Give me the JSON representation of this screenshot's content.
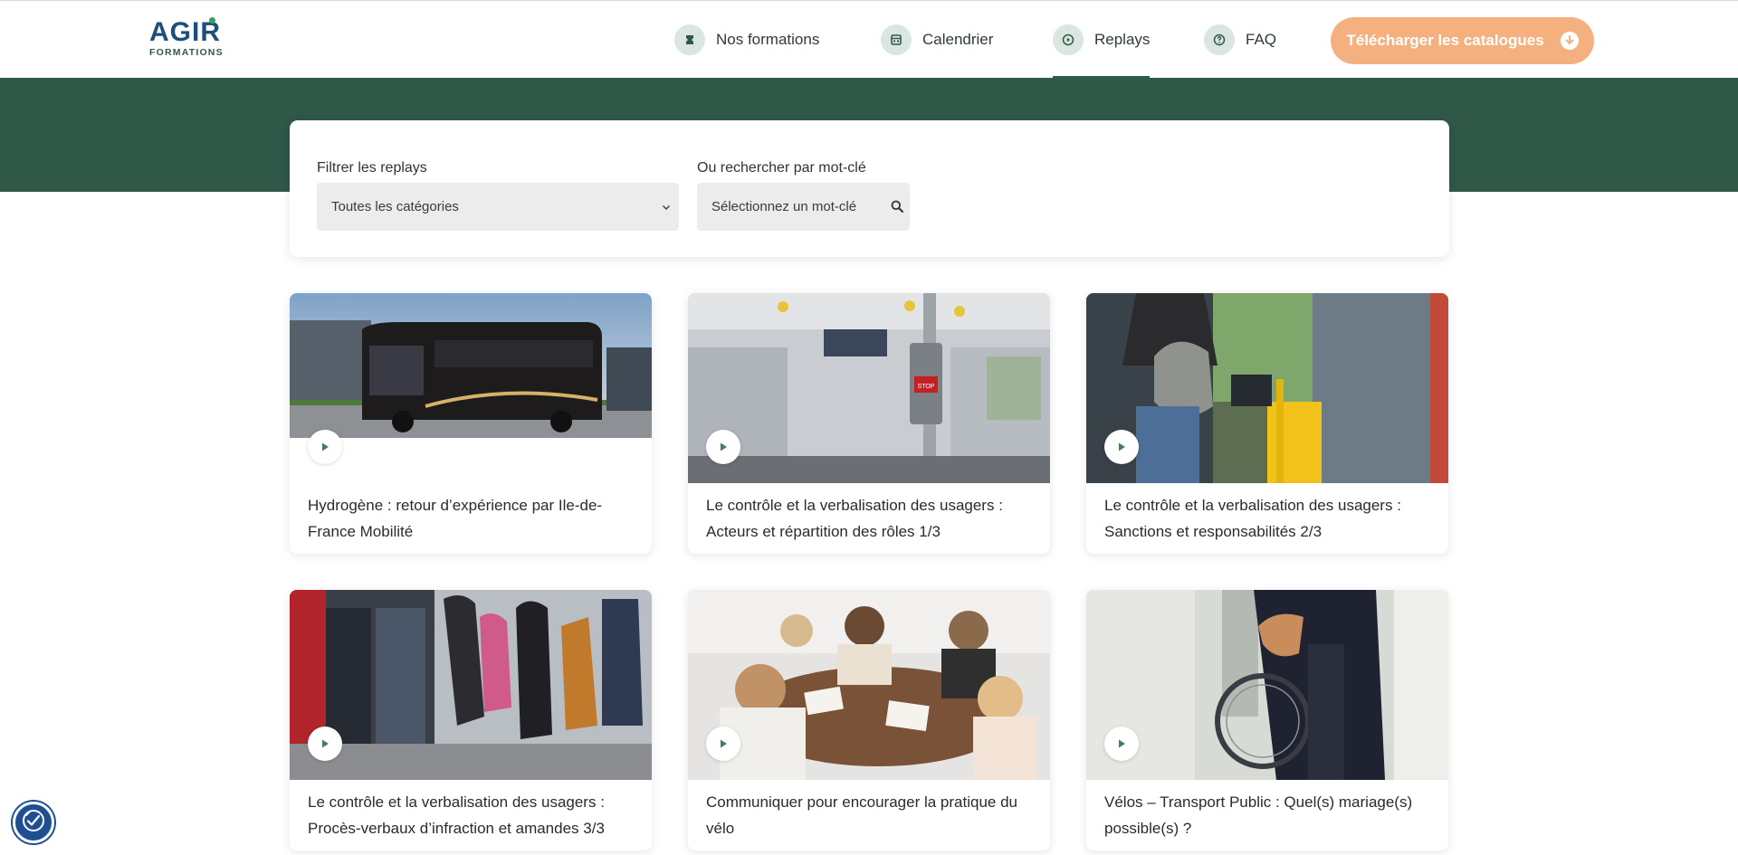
{
  "header": {
    "logo_main": "AGIR",
    "logo_sub": "FORMATIONS",
    "nav": [
      {
        "label": "Nos formations",
        "icon": "graduation-icon"
      },
      {
        "label": "Calendrier",
        "icon": "calendar-icon"
      },
      {
        "label": "Replays",
        "icon": "play-circle-icon",
        "active": true
      },
      {
        "label": "FAQ",
        "icon": "question-icon"
      }
    ],
    "cta_label": "Télécharger les catalogues",
    "cta_icon": "download-icon"
  },
  "filters": {
    "category_label": "Filtrer les replays",
    "category_value": "Toutes les catégories",
    "keyword_label": "Ou rechercher par mot-clé",
    "keyword_placeholder": "Sélectionnez un mot-clé"
  },
  "replays": [
    {
      "title": "Hydrogène : retour d’expérience par Ile-de-France Mobilité",
      "image": "bus-photo"
    },
    {
      "title": "Le contrôle et la verbalisation des usagers : Acteurs et répartition des rôles 1/3",
      "image": "bus-interior-photo"
    },
    {
      "title": "Le contrôle et la verbalisation des usagers : Sanctions et responsabilités 2/3",
      "image": "passenger-boarding-photo"
    },
    {
      "title": "Le contrôle et la verbalisation des usagers : Procès-verbaux d’infraction et amandes 3/3",
      "image": "crowd-boarding-photo"
    },
    {
      "title": "Communiquer pour encourager la pratique du vélo",
      "image": "meeting-photo"
    },
    {
      "title": "Vélos – Transport Public : Quel(s) mariage(s) possible(s) ?",
      "image": "bike-in-train-photo"
    }
  ],
  "colors": {
    "brand_green": "#2f5849",
    "cta_orange": "#f4b07f",
    "logo_blue": "#1d4f7a"
  }
}
